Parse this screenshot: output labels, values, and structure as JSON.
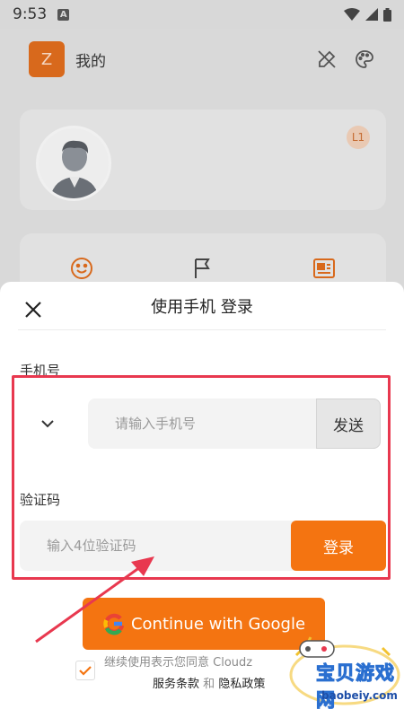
{
  "status_bar": {
    "time": "9:53",
    "a_badge": "A"
  },
  "app": {
    "avatar_letter": "Z",
    "title": "我的",
    "level": "L1"
  },
  "sheet": {
    "title": "使用手机 登录",
    "phone_label": "手机号",
    "phone_placeholder": "请输入手机号",
    "send_label": "发送",
    "code_label": "验证码",
    "code_placeholder": "输入4位验证码",
    "login_label": "登录",
    "google_label": "Continue with Google",
    "agree_text": "继续使用表示您同意 Cloudz",
    "terms_link": "服务条款",
    "and_text": "和",
    "privacy_link": "隐私政策"
  },
  "watermark": {
    "text": "宝贝游戏网",
    "url": "baobeiy.com"
  },
  "colors": {
    "accent": "#f47411",
    "highlight": "#e8384f",
    "arrow": "#e8384f"
  }
}
